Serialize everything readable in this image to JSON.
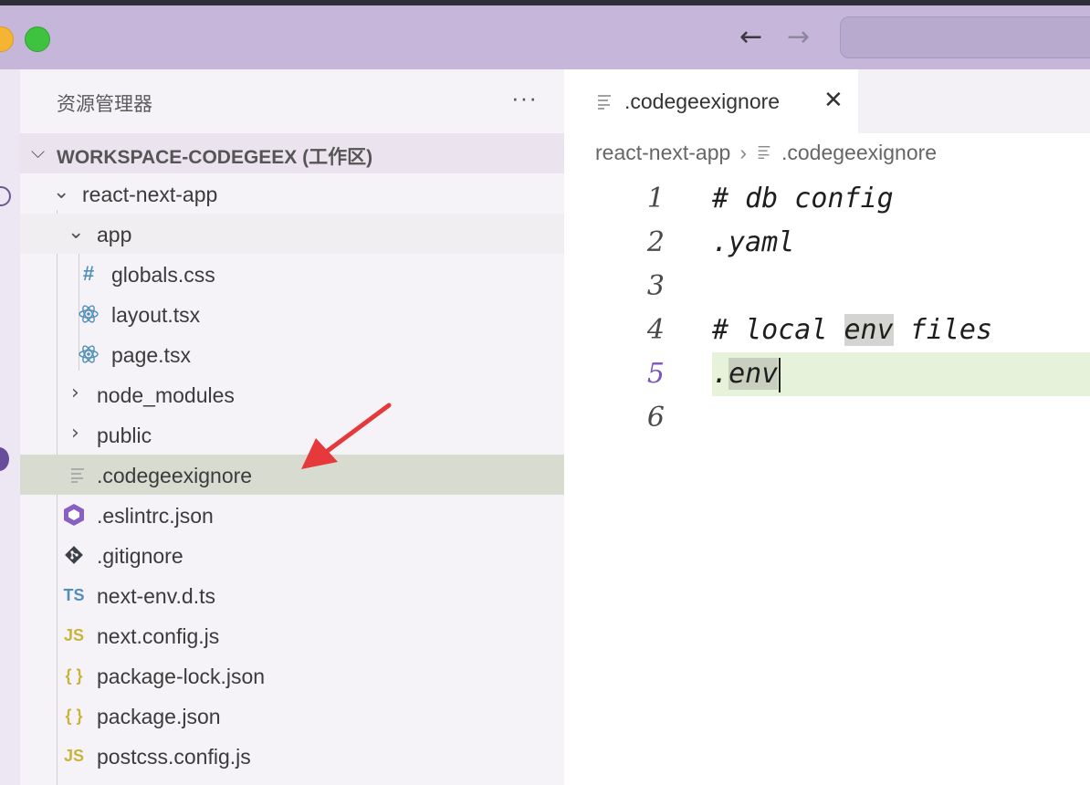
{
  "window": {
    "controls": [
      "minimize",
      "zoom"
    ],
    "nav": {
      "back_icon": "arrow-left-icon",
      "forward_icon": "arrow-right-icon"
    }
  },
  "sidebar": {
    "title": "资源管理器",
    "more_icon": "ellipsis-icon",
    "workspace_title": "WORKSPACE-CODEGEEX (工作区)",
    "tree": [
      {
        "label": "react-next-app",
        "type": "folder",
        "expanded": true
      },
      {
        "label": "app",
        "type": "folder",
        "expanded": true
      },
      {
        "label": "globals.css",
        "type": "file",
        "icon": "hash-icon",
        "icon_text": "#"
      },
      {
        "label": "layout.tsx",
        "type": "file",
        "icon": "react-icon"
      },
      {
        "label": "page.tsx",
        "type": "file",
        "icon": "react-icon"
      },
      {
        "label": "node_modules",
        "type": "folder",
        "expanded": false
      },
      {
        "label": "public",
        "type": "folder",
        "expanded": false
      },
      {
        "label": ".codegeexignore",
        "type": "file",
        "icon": "lines-icon",
        "selected": true
      },
      {
        "label": ".eslintrc.json",
        "type": "file",
        "icon": "eslint-icon"
      },
      {
        "label": ".gitignore",
        "type": "file",
        "icon": "git-icon"
      },
      {
        "label": "next-env.d.ts",
        "type": "file",
        "icon": "ts-icon",
        "icon_text": "TS"
      },
      {
        "label": "next.config.js",
        "type": "file",
        "icon": "js-icon",
        "icon_text": "JS"
      },
      {
        "label": "package-lock.json",
        "type": "file",
        "icon": "json-icon",
        "icon_text": "{ }"
      },
      {
        "label": "package.json",
        "type": "file",
        "icon": "json-icon",
        "icon_text": "{ }"
      },
      {
        "label": "postcss.config.js",
        "type": "file",
        "icon": "js-icon",
        "icon_text": "JS"
      }
    ]
  },
  "editor": {
    "tab": {
      "label": ".codegeexignore",
      "close_icon": "close-icon"
    },
    "breadcrumb": {
      "folder": "react-next-app",
      "file": ".codegeexignore"
    },
    "lines": [
      {
        "num": "1",
        "text": "# db config"
      },
      {
        "num": "2",
        "text": ".yaml"
      },
      {
        "num": "3",
        "text": ""
      },
      {
        "num": "4",
        "text_pre": "# local ",
        "text_hl": "env",
        "text_post": " files"
      },
      {
        "num": "5",
        "text_pre": ".",
        "text_hl": "env",
        "current": true
      },
      {
        "num": "6",
        "text": ""
      }
    ]
  },
  "colors": {
    "titlebar": "#c5b6da",
    "selection": "#d8dcd0",
    "current_line": "#e6f2d9",
    "annotation_arrow": "#e5393b"
  }
}
